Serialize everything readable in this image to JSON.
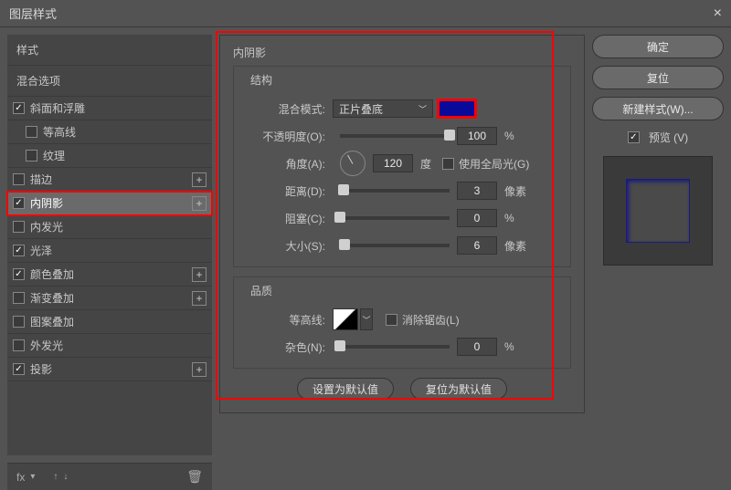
{
  "title": "图层样式",
  "sidebar": {
    "header_styles": "样式",
    "header_options": "混合选项",
    "items": [
      {
        "label": "斜面和浮雕",
        "checked": true,
        "plus": false,
        "indent": 0
      },
      {
        "label": "等高线",
        "checked": false,
        "plus": false,
        "indent": 1
      },
      {
        "label": "纹理",
        "checked": false,
        "plus": false,
        "indent": 1
      },
      {
        "label": "描边",
        "checked": false,
        "plus": true,
        "indent": 0
      },
      {
        "label": "内阴影",
        "checked": true,
        "plus": true,
        "indent": 0,
        "selected": true,
        "red": true
      },
      {
        "label": "内发光",
        "checked": false,
        "plus": false,
        "indent": 0
      },
      {
        "label": "光泽",
        "checked": true,
        "plus": false,
        "indent": 0
      },
      {
        "label": "颜色叠加",
        "checked": true,
        "plus": true,
        "indent": 0
      },
      {
        "label": "渐变叠加",
        "checked": false,
        "plus": true,
        "indent": 0
      },
      {
        "label": "图案叠加",
        "checked": false,
        "plus": false,
        "indent": 0
      },
      {
        "label": "外发光",
        "checked": false,
        "plus": false,
        "indent": 0
      },
      {
        "label": "投影",
        "checked": true,
        "plus": true,
        "indent": 0
      }
    ]
  },
  "panel": {
    "title": "内阴影",
    "structure": "结构",
    "quality": "品质",
    "blend_mode_label": "混合模式:",
    "blend_mode_value": "正片叠底",
    "swatch_color": "#0a0a9a",
    "opacity_label": "不透明度(O):",
    "opacity_value": "100",
    "percent": "%",
    "angle_label": "角度(A):",
    "angle_value": "120",
    "degree": "度",
    "global_light": "使用全局光(G)",
    "distance_label": "距离(D):",
    "distance_value": "3",
    "px": "像素",
    "choke_label": "阻塞(C):",
    "choke_value": "0",
    "size_label": "大小(S):",
    "size_value": "6",
    "contour_label": "等高线:",
    "antialias": "消除锯齿(L)",
    "noise_label": "杂色(N):",
    "noise_value": "0",
    "make_default": "设置为默认值",
    "reset_default": "复位为默认值"
  },
  "right": {
    "ok": "确定",
    "reset": "复位",
    "new_style": "新建样式(W)...",
    "preview": "预览 (V)"
  },
  "footer": {
    "fx": "fx"
  }
}
